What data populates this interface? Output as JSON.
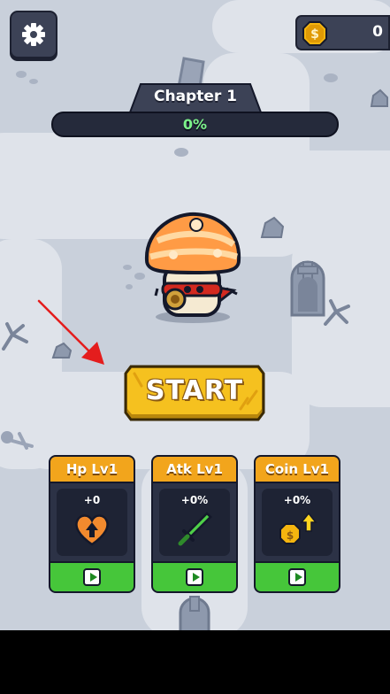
{
  "hud": {
    "coins": "0"
  },
  "chapter": {
    "title": "Chapter 1",
    "progress_text": "0%",
    "progress": 0
  },
  "start_label": "START",
  "upgrades": [
    {
      "title": "Hp Lv1",
      "value": "+0",
      "icon": "heart-arrow-icon"
    },
    {
      "title": "Atk Lv1",
      "value": "+0%",
      "icon": "sword-icon"
    },
    {
      "title": "Coin Lv1",
      "value": "+0%",
      "icon": "coin-arrow-icon"
    }
  ],
  "colors": {
    "button_yellow": "#f5c11f",
    "card_header": "#f2a51c",
    "card_footer": "#46c63a",
    "progress_green": "#5fe06a",
    "panel_dark": "#2c3246"
  }
}
